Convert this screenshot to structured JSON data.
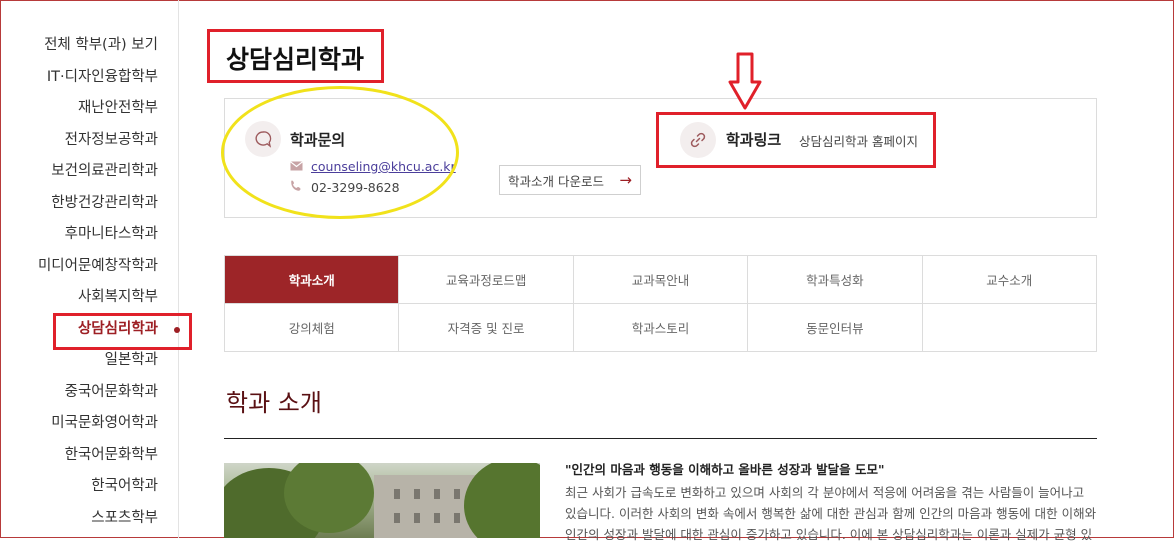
{
  "sidebar": {
    "items": [
      {
        "label": "전체 학부(과) 보기"
      },
      {
        "label": "IT·디자인융합학부"
      },
      {
        "label": "재난안전학부"
      },
      {
        "label": "전자정보공학과"
      },
      {
        "label": "보건의료관리학과"
      },
      {
        "label": "한방건강관리학과"
      },
      {
        "label": "후마니타스학과"
      },
      {
        "label": "미디어문예창작학과"
      },
      {
        "label": "사회복지학부"
      },
      {
        "label": "상담심리학과"
      },
      {
        "label": "일본학과"
      },
      {
        "label": "중국어문화학과"
      },
      {
        "label": "미국문화영어학과"
      },
      {
        "label": "한국어문화학부"
      },
      {
        "label": "한국어학과"
      },
      {
        "label": "스포츠학부"
      }
    ],
    "active_index": 9
  },
  "page": {
    "title": "상담심리학과"
  },
  "contact": {
    "title": "학과문의",
    "email": "counseling@khcu.ac.kr",
    "phone": "02-3299-8628",
    "download_label": "학과소개 다운로드",
    "download_arrow": "→"
  },
  "link": {
    "title": "학과링크",
    "text": "상담심리학과 홈페이지"
  },
  "tabs": [
    {
      "label": "학과소개",
      "active": true
    },
    {
      "label": "교육과정로드맵"
    },
    {
      "label": "교과목안내"
    },
    {
      "label": "학과특성화"
    },
    {
      "label": "교수소개"
    },
    {
      "label": "강의체험"
    },
    {
      "label": "자격증 및 진로"
    },
    {
      "label": "학과스토리"
    },
    {
      "label": "동문인터뷰"
    },
    {
      "label": ""
    }
  ],
  "section": {
    "title": "학과 소개",
    "quote": "\"인간의 마음과 행동을 이해하고 올바른 성장과 발달을 도모\"",
    "lines": [
      "최근 사회가 급속도로 변화하고 있으며 사회의 각 분야에서 적응에 어려움을 겪는 사람들이 늘어나고",
      "있습니다. 이러한 사회의 변화 속에서 행복한 삶에 대한 관심과 함께 인간의 마음과 행동에 대한 이해와",
      "인간의 성장과 발달에 대한 관심이 증가하고 있습니다. 이에 본 상담심리학과는 이론과 실제가 균형 있"
    ]
  },
  "colors": {
    "brand": "#9d2528",
    "annotation_red": "#e0202a",
    "annotation_yellow": "#f1e21b"
  },
  "icons": {
    "contact": "chat-bubble-icon",
    "email": "envelope-icon",
    "phone": "phone-icon",
    "link": "chain-link-icon",
    "annotation": "down-arrow-icon"
  }
}
